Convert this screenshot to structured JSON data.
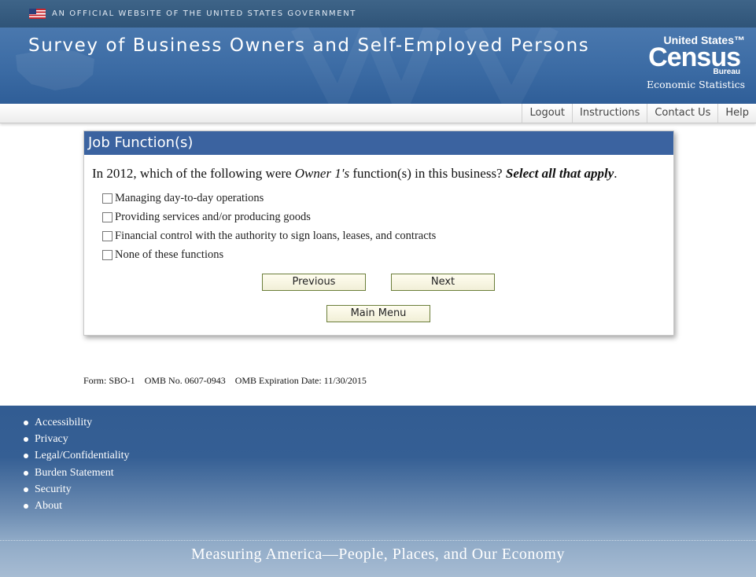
{
  "gov_bar": {
    "text": "AN OFFICIAL WEBSITE OF THE UNITED STATES GOVERNMENT"
  },
  "header": {
    "title": "Survey of Business Owners and Self-Employed Persons",
    "logo_line1": "United States™",
    "logo_line2": "Census",
    "logo_line3": "Bureau",
    "logo_line4": "Economic Statistics"
  },
  "nav": {
    "items": [
      "Logout",
      "Instructions",
      "Contact Us",
      "Help"
    ]
  },
  "card": {
    "title": "Job Function(s)",
    "question_pre": "In 2012, which of the following were ",
    "question_owner": "Owner 1's",
    "question_mid": " function(s) in this business? ",
    "question_emph": "Select all that apply",
    "question_end": ".",
    "options": [
      {
        "label": "Managing day-to-day operations",
        "checked": false
      },
      {
        "label": "Providing services and/or producing goods",
        "checked": false
      },
      {
        "label": "Financial control with the authority to sign loans, leases, and contracts",
        "checked": false
      },
      {
        "label": "None of these functions",
        "checked": false
      }
    ],
    "previous_label": "Previous",
    "next_label": "Next",
    "main_menu_label": "Main Menu"
  },
  "form_info": {
    "form": "Form: SBO-1",
    "omb": "OMB No. 0607-0943",
    "expiration": "OMB Expiration Date: 11/30/2015"
  },
  "footer": {
    "links": [
      "Accessibility",
      "Privacy",
      "Legal/Confidentiality",
      "Burden Statement",
      "Security",
      "About"
    ],
    "tagline": "Measuring America—People, Places, and Our Economy"
  },
  "colors": {
    "header_blue": "#3b63a0",
    "gov_bar": "#2f5478",
    "button_border": "#6b7e3a"
  }
}
